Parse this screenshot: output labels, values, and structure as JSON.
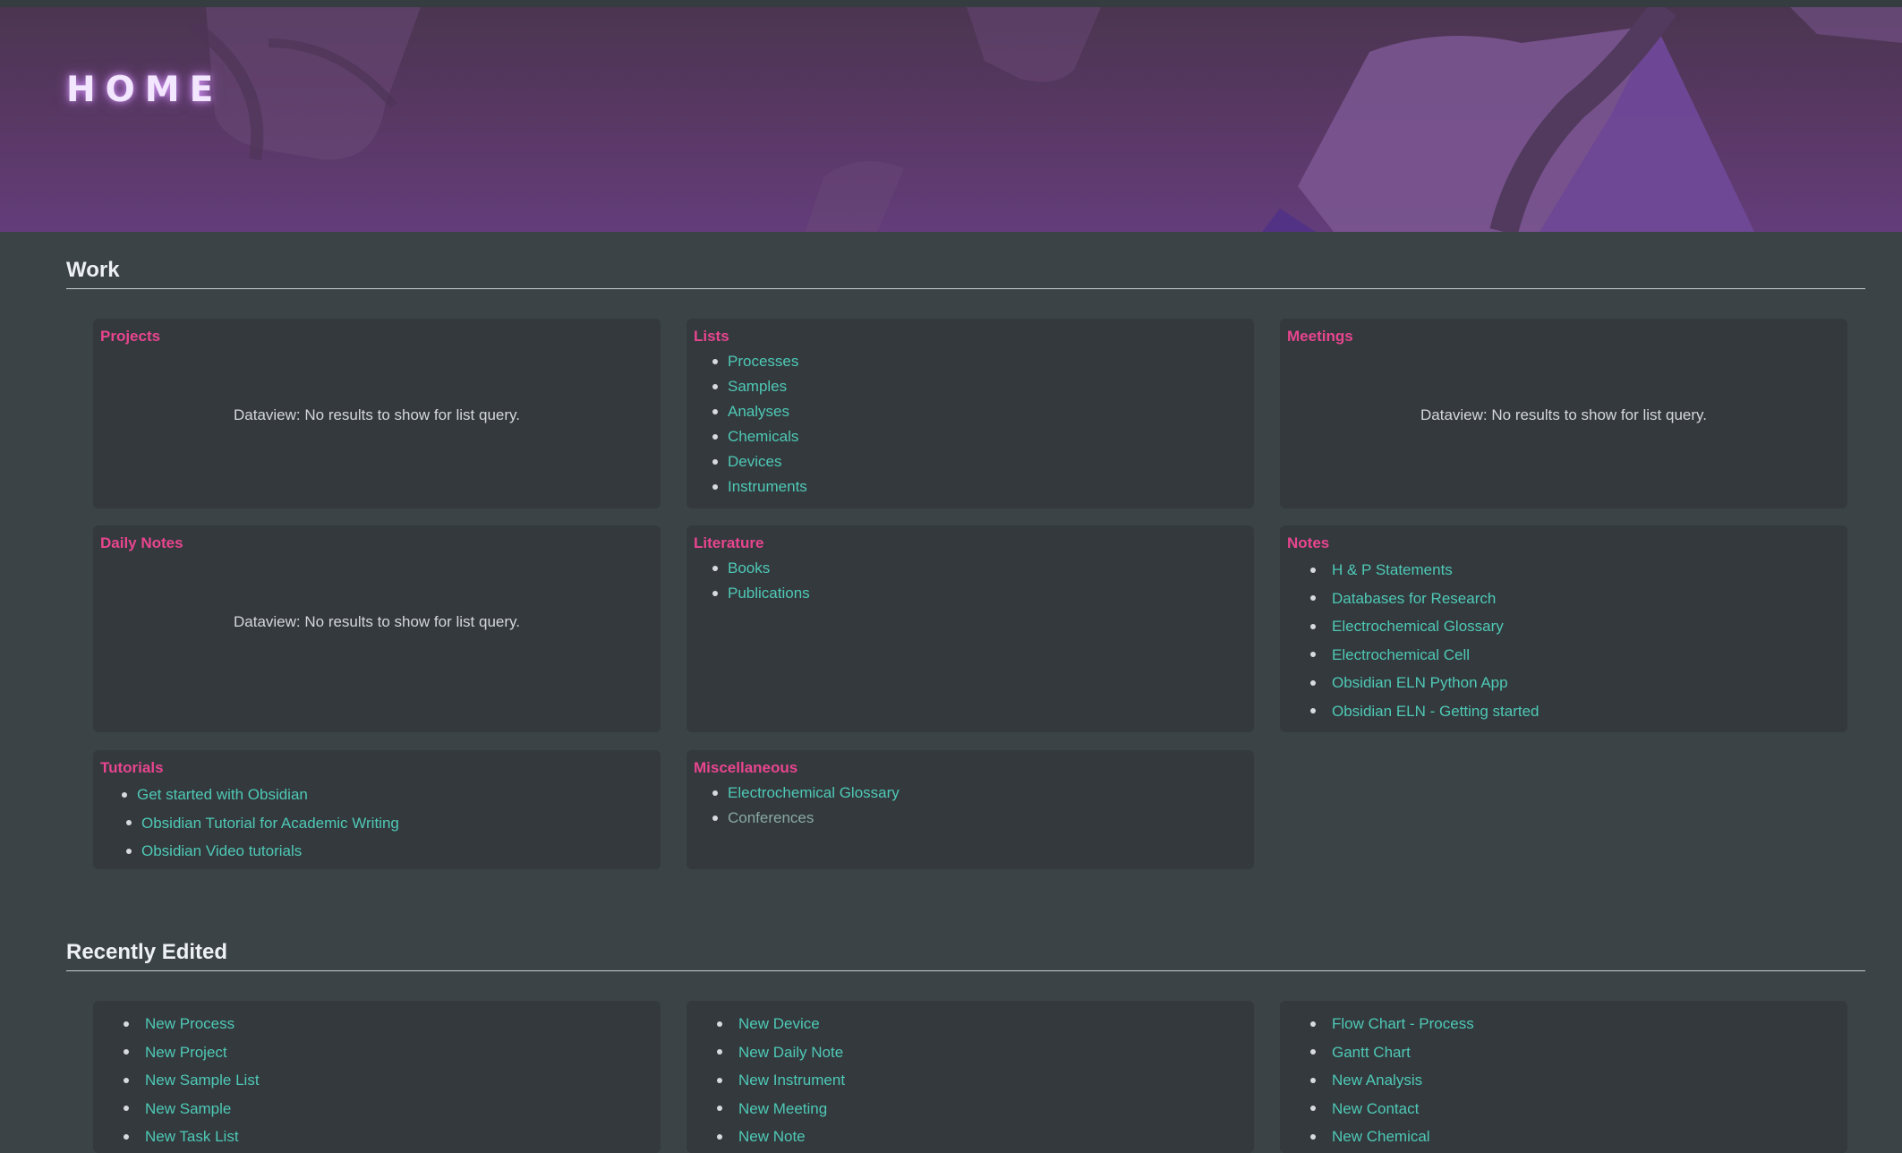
{
  "banner": {
    "title": "HOME"
  },
  "work": {
    "heading": "Work",
    "cards": {
      "projects": {
        "title": "Projects",
        "message": "Dataview: No results to show for list query."
      },
      "lists": {
        "title": "Lists",
        "items": [
          "Processes",
          "Samples",
          "Analyses",
          "Chemicals",
          "Devices",
          "Instruments"
        ]
      },
      "meetings": {
        "title": "Meetings",
        "message": "Dataview: No results to show for list query."
      },
      "daily_notes": {
        "title": "Daily Notes",
        "message": "Dataview: No results to show for list query."
      },
      "literature": {
        "title": "Literature",
        "items": [
          "Books",
          "Publications"
        ]
      },
      "notes": {
        "title": "Notes",
        "items": [
          "H & P Statements",
          "Databases for Research",
          "Electrochemical Glossary",
          "Electrochemical Cell",
          "Obsidian ELN Python App",
          "Obsidian ELN - Getting started"
        ]
      },
      "tutorials": {
        "title": "Tutorials",
        "items": [
          "Get started with Obsidian",
          "Obsidian Tutorial for Academic Writing",
          "Obsidian Video tutorials"
        ]
      },
      "miscellaneous": {
        "title": "Miscellaneous",
        "items": [
          "Electrochemical Glossary",
          "Conferences"
        ]
      }
    }
  },
  "recent": {
    "heading": "Recently Edited",
    "col1": [
      "New Process",
      "New Project",
      "New Sample List",
      "New Sample",
      "New Task List"
    ],
    "col2": [
      "New Device",
      "New Daily Note",
      "New Instrument",
      "New Meeting",
      "New Note"
    ],
    "col3": [
      "Flow Chart - Process",
      "Gantt Chart",
      "New Analysis",
      "New Contact",
      "New Chemical"
    ]
  },
  "colors": {
    "background": "#3c4347",
    "card": "#33393d",
    "card_title": "#e8458f",
    "link": "#4fc9b6",
    "text": "#d5d8da"
  }
}
